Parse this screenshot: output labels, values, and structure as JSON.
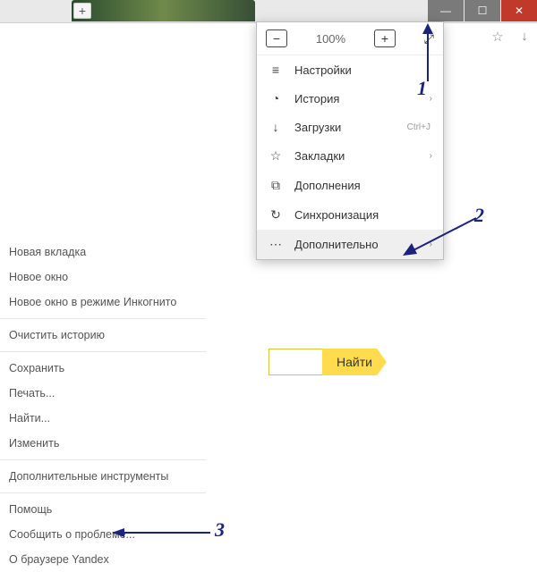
{
  "window": {
    "min": "—",
    "max": "☐",
    "close": "✕"
  },
  "toolbar": {
    "star": "☆",
    "down": "↓"
  },
  "zoom": {
    "minus": "−",
    "percent": "100%",
    "plus": "+",
    "fullscreen": "⤢"
  },
  "menu": {
    "settings": {
      "icon": "≡",
      "label": "Настройки"
    },
    "history": {
      "icon": "◔",
      "label": "История",
      "arrow": "›"
    },
    "downloads": {
      "icon": "↓",
      "label": "Загрузки",
      "shortcut": "Ctrl+J"
    },
    "bookmarks": {
      "icon": "☆",
      "label": "Закладки",
      "arrow": "›"
    },
    "addons": {
      "icon": "⧉",
      "label": "Дополнения"
    },
    "sync": {
      "icon": "↻",
      "label": "Синхронизация"
    },
    "more": {
      "icon": "⋯",
      "label": "Дополнительно",
      "arrow": "›"
    }
  },
  "submenu": {
    "new_tab": "Новая вкладка",
    "new_window": "Новое окно",
    "incognito": "Новое окно в режиме Инкогнито",
    "clear_history": "Очистить историю",
    "save": "Сохранить",
    "print": "Печать...",
    "find": "Найти...",
    "edit": "Изменить",
    "extra_tools": "Дополнительные инструменты",
    "help": "Помощь",
    "report": "Сообщить о проблеме...",
    "about": "О браузере Yandex"
  },
  "search": {
    "label": "Найти"
  },
  "annotations": {
    "n1": "1",
    "n2": "2",
    "n3": "3"
  },
  "newtab_plus": "+"
}
